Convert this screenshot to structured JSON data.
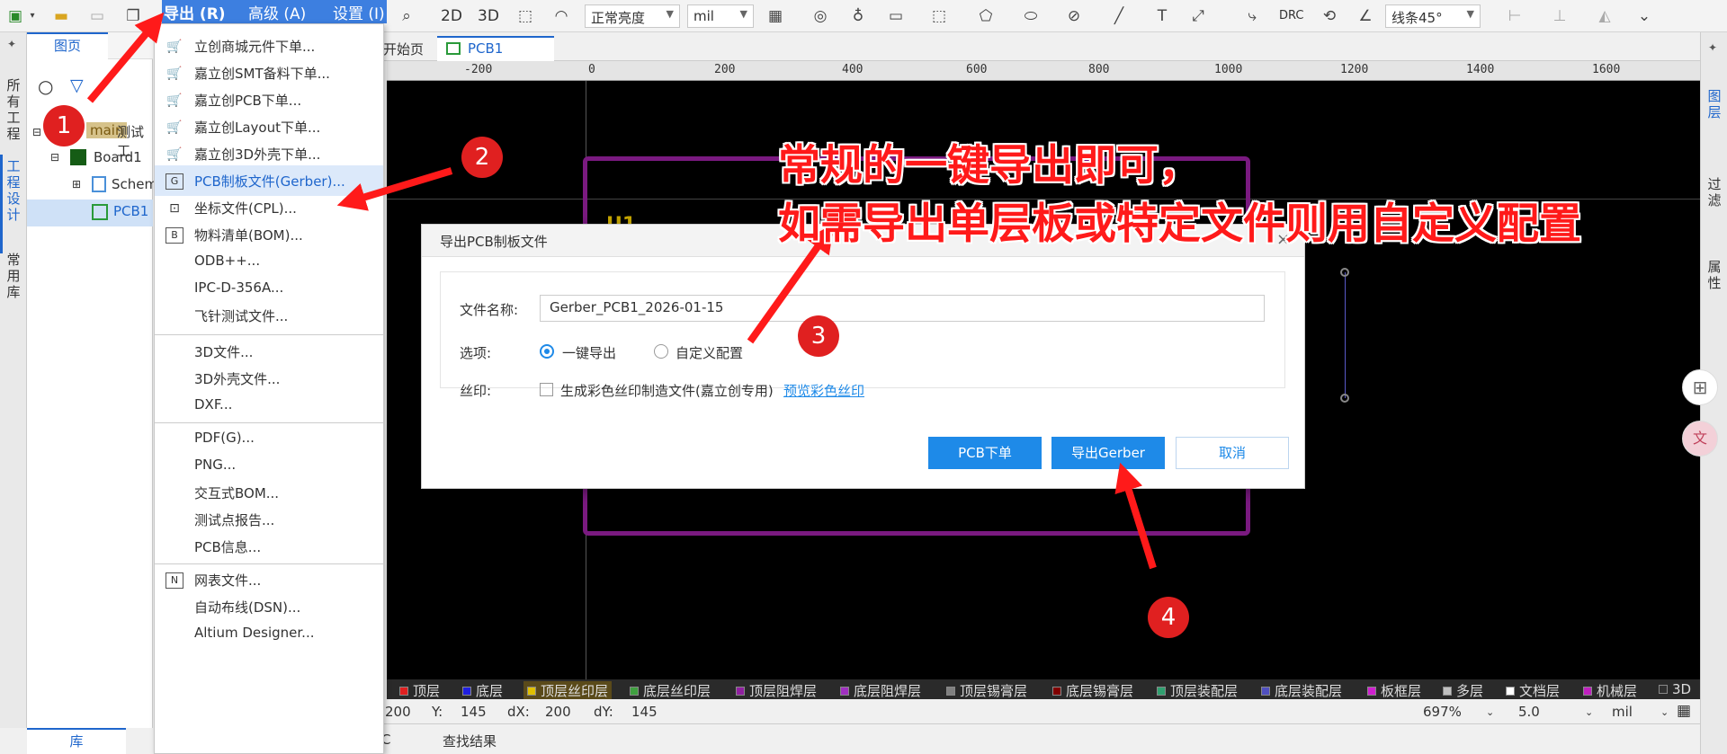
{
  "menubar": {
    "export": "导出 (R)",
    "advanced": "高级 (A)",
    "settings": "设置 (I)"
  },
  "toolbar": {
    "view_2d": "2D",
    "view_3d": "3D",
    "brightness": "正常亮度",
    "unit": "mil",
    "drc": "DRC",
    "line_angle": "线条45°"
  },
  "left_rail": {
    "all_projects": "所有工程",
    "project_design": "工程设计",
    "common_lib": "常用库"
  },
  "project_panel": {
    "tab": "图页",
    "tree": {
      "main": "main",
      "project_name": "测试工",
      "board": "Board1",
      "schematic": "Schem",
      "pcb": "PCB1"
    }
  },
  "doc_tabs": {
    "start": "开始页",
    "pcb": "PCB1"
  },
  "ruler": [
    "-200",
    "0",
    "200",
    "400",
    "600",
    "800",
    "1000",
    "1200",
    "1400",
    "1600"
  ],
  "export_menu": {
    "groups": [
      [
        {
          "icon": "cart-icon",
          "label": "立创商城元件下单..."
        },
        {
          "icon": "cart-icon",
          "label": "嘉立创SMT备料下单..."
        },
        {
          "icon": "cart-icon",
          "label": "嘉立创PCB下单..."
        },
        {
          "icon": "cart-icon",
          "label": "嘉立创Layout下单..."
        },
        {
          "icon": "cart-icon",
          "label": "嘉立创3D外壳下单..."
        },
        {
          "icon": "gerber-icon",
          "label": "PCB制板文件(Gerber)...",
          "highlighted": true
        },
        {
          "icon": "coordinate-icon",
          "label": "坐标文件(CPL)..."
        },
        {
          "icon": "bom-icon",
          "label": "物料清单(BOM)..."
        },
        {
          "icon": "",
          "label": "ODB++..."
        },
        {
          "icon": "",
          "label": "IPC-D-356A..."
        },
        {
          "icon": "",
          "label": "飞针测试文件..."
        }
      ],
      [
        {
          "icon": "",
          "label": "3D文件..."
        },
        {
          "icon": "",
          "label": "3D外壳文件..."
        },
        {
          "icon": "",
          "label": "DXF..."
        }
      ],
      [
        {
          "icon": "",
          "label": "PDF(G)..."
        },
        {
          "icon": "",
          "label": "PNG..."
        },
        {
          "icon": "",
          "label": "交互式BOM..."
        },
        {
          "icon": "",
          "label": "测试点报告..."
        },
        {
          "icon": "",
          "label": "PCB信息..."
        }
      ],
      [
        {
          "icon": "netlist-icon",
          "label": "网表文件..."
        },
        {
          "icon": "",
          "label": "自动布线(DSN)..."
        },
        {
          "icon": "",
          "label": "Altium Designer..."
        }
      ]
    ]
  },
  "dialog": {
    "title": "导出PCB制板文件",
    "filename_label": "文件名称:",
    "filename_value": "Gerber_PCB1_2026-01-15",
    "options_label": "选项:",
    "option_one_click": "一键导出",
    "option_custom": "自定义配置",
    "silk_label": "丝印:",
    "silk_checkbox": "生成彩色丝印制造文件(嘉立创专用)",
    "silk_link": "预览彩色丝印",
    "btn_pcb_order": "PCB下单",
    "btn_export": "导出Gerber",
    "btn_cancel": "取消"
  },
  "canvas": {
    "designator": "U1"
  },
  "layers": [
    {
      "name": "顶层",
      "color": "#e02020"
    },
    {
      "name": "底层",
      "color": "#2020e0"
    },
    {
      "name": "顶层丝印层",
      "color": "#e0c000"
    },
    {
      "name": "底层丝印层",
      "color": "#40a040"
    },
    {
      "name": "顶层阻焊层",
      "color": "#9020a0"
    },
    {
      "name": "底层阻焊层",
      "color": "#a030c0"
    },
    {
      "name": "顶层锡膏层",
      "color": "#808080"
    },
    {
      "name": "底层锡膏层",
      "color": "#800000"
    },
    {
      "name": "顶层装配层",
      "color": "#30a070"
    },
    {
      "name": "底层装配层",
      "color": "#5050c0"
    },
    {
      "name": "板框层",
      "color": "#d020d0"
    },
    {
      "name": "多层",
      "color": "#c0c0c0"
    },
    {
      "name": "文档层",
      "color": "#ffffff"
    },
    {
      "name": "机械层",
      "color": "#c020c0"
    },
    {
      "name": "3D",
      "color": "#303030"
    }
  ],
  "status": {
    "x_val": "200",
    "y_label": "Y:",
    "y_val": "145",
    "dx_label": "dX:",
    "dx_val": "200",
    "dy_label": "dY:",
    "dy_val": "145",
    "zoom": "697%",
    "grid": "5.0",
    "unit": "mil"
  },
  "bottom": {
    "lib_tab": "库",
    "find_results": "查找结果",
    "c_tab": "C"
  },
  "right_rail": {
    "layers": "图层",
    "filter": "过滤",
    "properties": "属性"
  },
  "annotations": {
    "line1": "常规的一键导出即可，",
    "line2": "如需导出单层板或特定文件则用自定义配置",
    "n1": "1",
    "n2": "2",
    "n3": "3",
    "n4": "4"
  }
}
